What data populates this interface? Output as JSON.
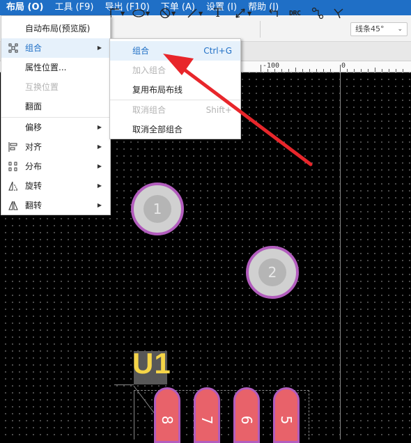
{
  "menubar": {
    "items": [
      {
        "label": "布局 (O)"
      },
      {
        "label": "工具 (F9)"
      },
      {
        "label": "导出 (F10)"
      },
      {
        "label": "下单 (A)"
      },
      {
        "label": "设置 (I)"
      },
      {
        "label": "帮助 (J)"
      }
    ]
  },
  "toolbar": {
    "drc_label": "DRC",
    "text_tool_glyph": "T",
    "line_style_select": "线条45°"
  },
  "ruler": {
    "labels": [
      "-100",
      "0"
    ]
  },
  "layout_menu": {
    "items": [
      {
        "label": "自动布局(预览版)",
        "enabled": true
      },
      {
        "label": "组合",
        "enabled": true,
        "icon": "group-icon",
        "submenu": true
      },
      {
        "label": "属性位置...",
        "enabled": true
      },
      {
        "label": "互换位置",
        "enabled": false
      },
      {
        "label": "翻面",
        "enabled": true
      },
      {
        "label": "偏移",
        "enabled": true,
        "submenu": true
      },
      {
        "label": "对齐",
        "enabled": true,
        "icon": "align-icon",
        "submenu": true
      },
      {
        "label": "分布",
        "enabled": true,
        "icon": "distribute-icon",
        "submenu": true
      },
      {
        "label": "旋转",
        "enabled": true,
        "icon": "rotate-icon",
        "submenu": true
      },
      {
        "label": "翻转",
        "enabled": true,
        "icon": "flip-icon",
        "submenu": true
      }
    ]
  },
  "group_submenu": {
    "items": [
      {
        "label": "组合",
        "shortcut": "Ctrl+G",
        "enabled": true,
        "highlighted": true
      },
      {
        "label": "加入组合",
        "shortcut": "",
        "enabled": false
      },
      {
        "label": "复用布局布线",
        "shortcut": "",
        "enabled": true
      },
      {
        "label": "取消组合",
        "shortcut": "Shift+",
        "enabled": false
      },
      {
        "label": "取消全部组合",
        "shortcut": "",
        "enabled": true
      }
    ]
  },
  "canvas": {
    "pads": [
      {
        "number": "1"
      },
      {
        "number": "2"
      }
    ],
    "designator": "U1",
    "smd_pads": [
      {
        "number": "8"
      },
      {
        "number": "7"
      },
      {
        "number": "6"
      },
      {
        "number": "5"
      }
    ]
  },
  "colors": {
    "menubar_bg": "#1f6fc6",
    "canvas_bg": "#000000",
    "pad_ring": "#b25dbd",
    "smd_pad": "#e8626a",
    "designator": "#f5d547",
    "arrow": "#e8262b",
    "highlight_text": "#1f6fc6"
  }
}
